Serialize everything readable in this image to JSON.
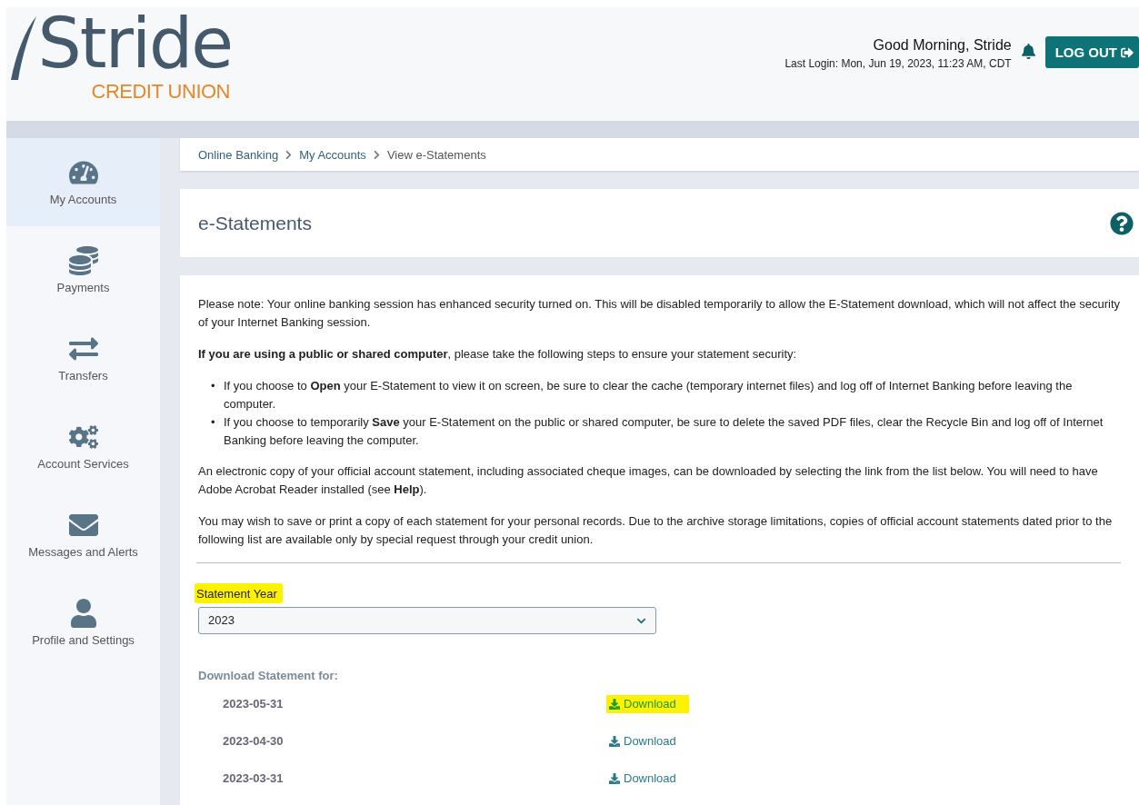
{
  "header": {
    "logo": {
      "name": "Stride",
      "subtitle": "CREDIT UNION"
    },
    "greeting": "Good Morning, Stride",
    "last_login": "Last Login: Mon, Jun 19, 2023, 11:23 AM, CDT",
    "logout_button": "LOG OUT"
  },
  "sidebar": {
    "items": [
      {
        "label": "My Accounts",
        "selected": true
      },
      {
        "label": "Payments",
        "selected": false
      },
      {
        "label": "Transfers",
        "selected": false
      },
      {
        "label": "Account Services",
        "selected": false
      },
      {
        "label": "Messages and Alerts",
        "selected": false
      },
      {
        "label": "Profile and Settings",
        "selected": false
      }
    ]
  },
  "breadcrumb": [
    "Online Banking",
    "My Accounts",
    "View e-Statements"
  ],
  "page_title": "e-Statements",
  "notice": [
    {
      "kind": "paragraph",
      "text": "Please note: Your online banking session has enhanced security turned on. This will be disabled temporarily to allow the E-Statement download, which will not affect the security of your Internet Banking session."
    },
    {
      "kind": "paragraph",
      "text": "**If you are using a public or shared computer**, please take the following steps to ensure your statement security:"
    },
    {
      "kind": "list",
      "marker": "•",
      "items": [
        "If you choose to **Open** your E-Statement to view it on screen, be sure to clear the cache (temporary internet files) and log off of Internet Banking before leaving the computer.",
        "If you choose to temporarily **Save** your E-Statement on the public or shared computer, be sure to delete the saved PDF files, clear the Recycle Bin and log off of Internet Banking before leaving the computer."
      ]
    },
    {
      "kind": "paragraph",
      "text": "An electronic copy of your official account statement, including associated cheque images, can be downloaded by selecting the link from the list below. You will need to have Adobe Acrobat Reader installed (see **Help**)."
    },
    {
      "kind": "paragraph",
      "text": "You may wish to save or print a copy of each statement for your personal records. Due to the archive storage limitations, copies of official account statements dated prior to the following list are available only by special request through your credit union."
    }
  ],
  "year_field": {
    "label": "Statement Year",
    "highlighted": true,
    "value": "2023"
  },
  "download_heading": "Download Statement for:",
  "statements": [
    {
      "date": "2023-05-31",
      "link": "Download",
      "highlighted": true
    },
    {
      "date": "2023-04-30",
      "link": "Download",
      "highlighted": false
    },
    {
      "date": "2023-03-31",
      "link": "Download",
      "highlighted": false
    }
  ]
}
